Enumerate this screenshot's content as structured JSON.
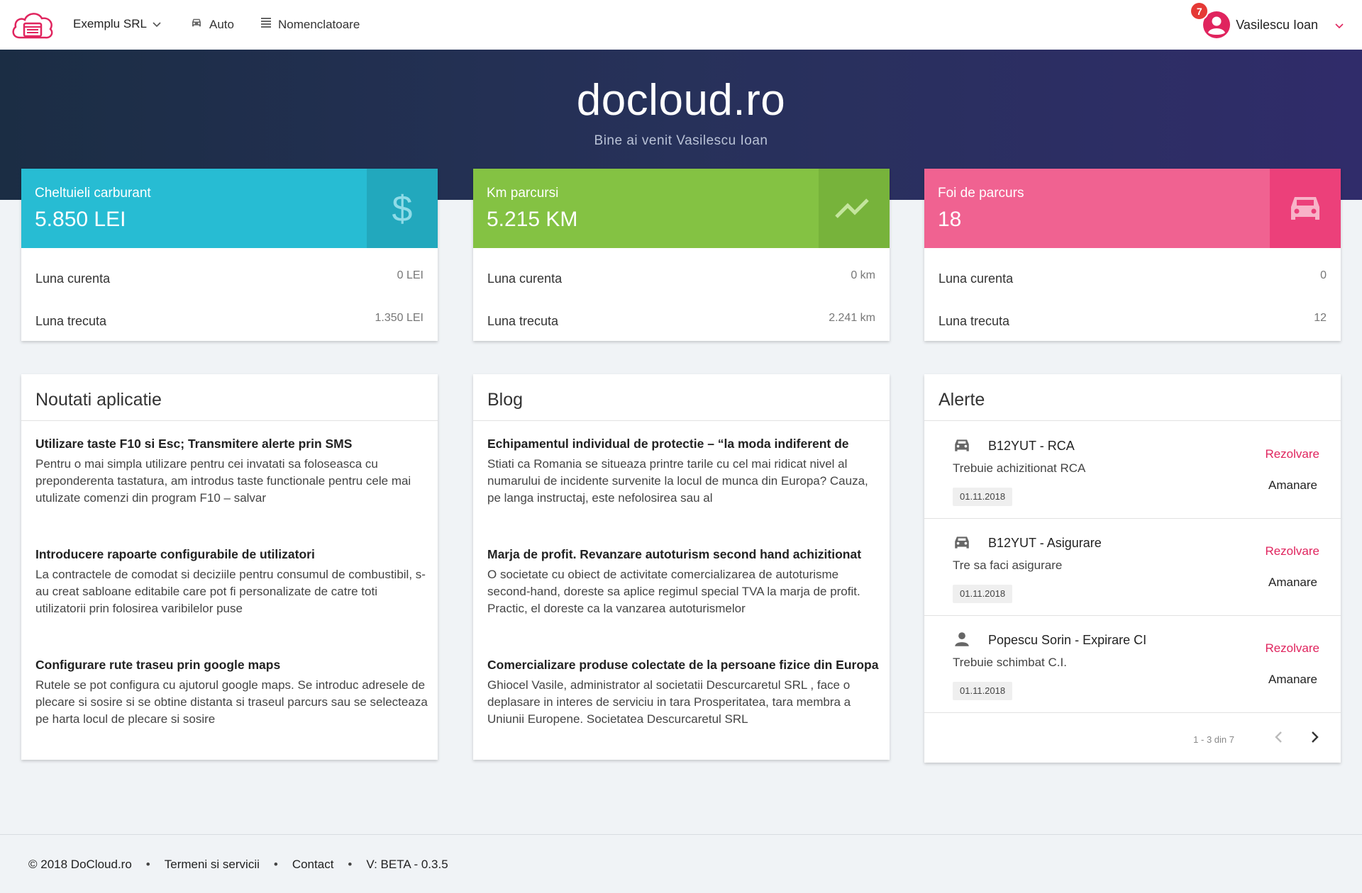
{
  "topbar": {
    "company": "Exemplu SRL",
    "nav": {
      "auto": "Auto",
      "nomenclatoare": "Nomenclatoare"
    },
    "notifications": "7",
    "user_name": "Vasilescu Ioan"
  },
  "hero": {
    "title": "docloud.ro",
    "subtitle": "Bine ai venit Vasilescu Ioan"
  },
  "stats": [
    {
      "label": "Cheltuieli carburant",
      "value": "5.850 LEI",
      "row1_label": "Luna curenta",
      "row1_value": "0 LEI",
      "row2_label": "Luna trecuta",
      "row2_value": "1.350 LEI",
      "icon": "dollar-icon",
      "color": "#27bcd3"
    },
    {
      "label": "Km parcursi",
      "value": "5.215 KM",
      "row1_label": "Luna curenta",
      "row1_value": "0 km",
      "row2_label": "Luna trecuta",
      "row2_value": "2.241 km",
      "icon": "trending-up-icon",
      "color": "#84c243"
    },
    {
      "label": "Foi de parcurs",
      "value": "18",
      "row1_label": "Luna curenta",
      "row1_value": "0",
      "row2_label": "Luna trecuta",
      "row2_value": "12",
      "icon": "car-icon",
      "color": "#f06291"
    }
  ],
  "news": {
    "title": "Noutati aplicatie",
    "items": [
      {
        "title": "Utilizare taste F10 si Esc; Transmitere alerte prin SMS",
        "body": "Pentru o mai simpla utilizare pentru cei invatati sa foloseasca cu preponderenta tastatura, am introdus taste functionale pentru cele mai utulizate comenzi din program F10 – salvar"
      },
      {
        "title": "Introducere rapoarte configurabile de utilizatori",
        "body": "La contractele de comodat si deciziile pentru consumul de combustibil, s-au creat sabloane editabile care pot fi personalizate de catre toti utilizatorii prin folosirea varibilelor puse"
      },
      {
        "title": "Configurare rute traseu prin google maps",
        "body": "Rutele se pot configura cu ajutorul google maps. Se introduc adresele de plecare si sosire si se obtine distanta si traseul parcurs sau se selecteaza pe harta locul de plecare si sosire"
      }
    ]
  },
  "blog": {
    "title": "Blog",
    "items": [
      {
        "title": "Echipamentul individual de protectie – “la moda indiferent de",
        "body": "Stiati ca Romania se situeaza printre tarile cu cel mai ridicat nivel al numarului de incidente survenite la locul de munca din Europa? Cauza, pe langa instructaj, este nefolosirea sau al"
      },
      {
        "title": "Marja de profit. Revanzare autoturism second hand achizitionat",
        "body": "O societate cu obiect de activitate comercializarea de autoturisme second-hand, doreste sa aplice regimul special TVA la marja de profit. Practic, el doreste ca la vanzarea autoturismelor"
      },
      {
        "title": "Comercializare produse colectate de la persoane fizice din Europa",
        "body": "Ghiocel Vasile, administrator al societatii Descurcaretul SRL , face o deplasare in interes de serviciu in tara Prosperitatea, tara membra a Uniunii Europene. Societatea Descurcaretul SRL"
      }
    ]
  },
  "alerts": {
    "title": "Alerte",
    "items": [
      {
        "icon": "car-icon",
        "title": "B12YUT - RCA",
        "desc": "Trebuie achizitionat RCA",
        "date": "01.11.2018",
        "resolve": "Rezolvare",
        "postpone": "Amanare"
      },
      {
        "icon": "car-icon",
        "title": "B12YUT - Asigurare",
        "desc": "Tre sa faci asigurare",
        "date": "01.11.2018",
        "resolve": "Rezolvare",
        "postpone": "Amanare"
      },
      {
        "icon": "person-icon",
        "title": "Popescu Sorin - Expirare CI",
        "desc": "Trebuie schimbat C.I.",
        "date": "01.11.2018",
        "resolve": "Rezolvare",
        "postpone": "Amanare"
      }
    ],
    "pagination": "1 - 3 din 7"
  },
  "footer": {
    "copyright": "© 2018 DoCloud.ro",
    "terms": "Termeni si servicii",
    "contact": "Contact",
    "version": "V: BETA - 0.3.5",
    "separator": "•"
  }
}
